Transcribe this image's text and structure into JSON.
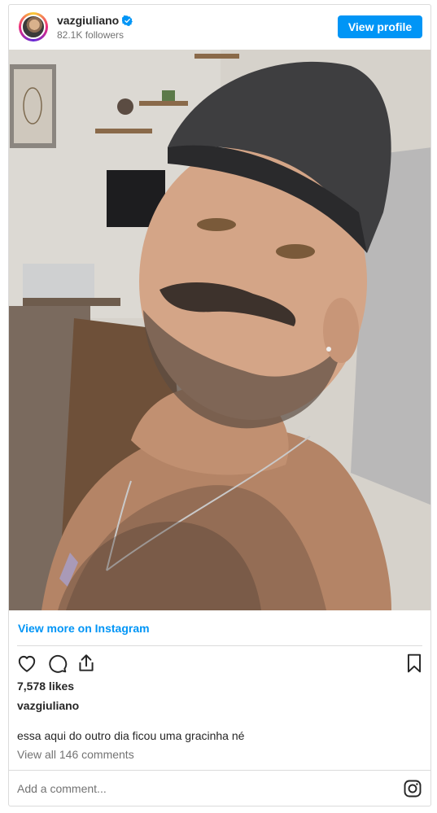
{
  "header": {
    "username": "vazgiuliano",
    "followers": "82.1K followers",
    "view_profile_label": "View profile",
    "verified_icon": "verified-badge-icon",
    "accent_color": "#0095f6"
  },
  "post": {
    "image_alt": "selfie photo",
    "view_more_label": "View more on Instagram",
    "action_icons": [
      "heart-icon",
      "comment-icon",
      "share-icon",
      "bookmark-icon"
    ],
    "likes": "7,578 likes",
    "caption_user": "vazgiuliano",
    "caption_text": "essa aqui do outro dia ficou uma gracinha né",
    "view_comments_label": "View all 146 comments",
    "add_comment_placeholder": "Add a comment..."
  }
}
